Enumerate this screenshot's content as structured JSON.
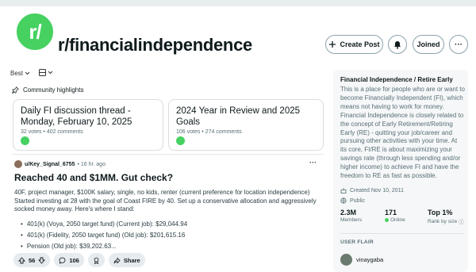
{
  "subreddit": {
    "avatar_text": "r/",
    "name": "r/financialindependence"
  },
  "header_buttons": {
    "create_post": "Create Post",
    "joined": "Joined",
    "more": "···"
  },
  "toolbar": {
    "sort": "Best",
    "view_icon": "card-view-icon"
  },
  "highlights": {
    "label": "Community highlights",
    "cards": [
      {
        "title": "Daily FI discussion thread - Monday, February 10, 2025",
        "meta": "32 votes • 402 comments"
      },
      {
        "title": "2024 Year in Review and 2025 Goals",
        "meta": "106 votes • 274 comments"
      }
    ]
  },
  "post": {
    "user": "u/Key_Signal_6755",
    "time": "• 16 hr. ago",
    "title": "Reached 40 and $1MM. Gut check?",
    "body": "40F, project manager, $100K salary, single, no kids, renter (current preference for location independence) Started investing at 28 with the goal of Coast FIRE by 40. Set up a conservative allocation and aggressively socked money away. Here's where I stand:",
    "list": [
      "401(k) (Voya, 2050 target fund) (Current job): $29,044.94",
      "401(k) (Fidelity, 2050 target fund) (Old job): $201,615.16",
      "Pension (Old job): $39,202.63..."
    ],
    "votes": "56",
    "comments": "106",
    "share": "Share"
  },
  "sidebar": {
    "title": "Financial Independence / Retire Early",
    "description": "This is a place for people who are or want to become Financially Independent (FI), which means not having to work for money. Financial Independence is closely related to the concept of Early Retirement/Retiring Early (RE) - quitting your job/career and pursuing other activities with your time. At its core, FI/RE is about maximizing your savings rate (through less spending and/or higher income) to achieve FI and have the freedom to RE as fast as possible.",
    "created": "Created Nov 10, 2011",
    "visibility": "Public",
    "stats": {
      "members_value": "2.3M",
      "members_label": "Members",
      "online_value": "171",
      "online_label": "Online",
      "rank_value": "Top 1%",
      "rank_label": "Rank by size"
    },
    "flair_header": "USER FLAIR",
    "flair_user": "vinaygaba"
  },
  "colors": {
    "accent": "#46d160",
    "border": "#8ba2ad",
    "pill_bg": "#e5ebee",
    "sidebar_bg": "#f6f7f8"
  }
}
